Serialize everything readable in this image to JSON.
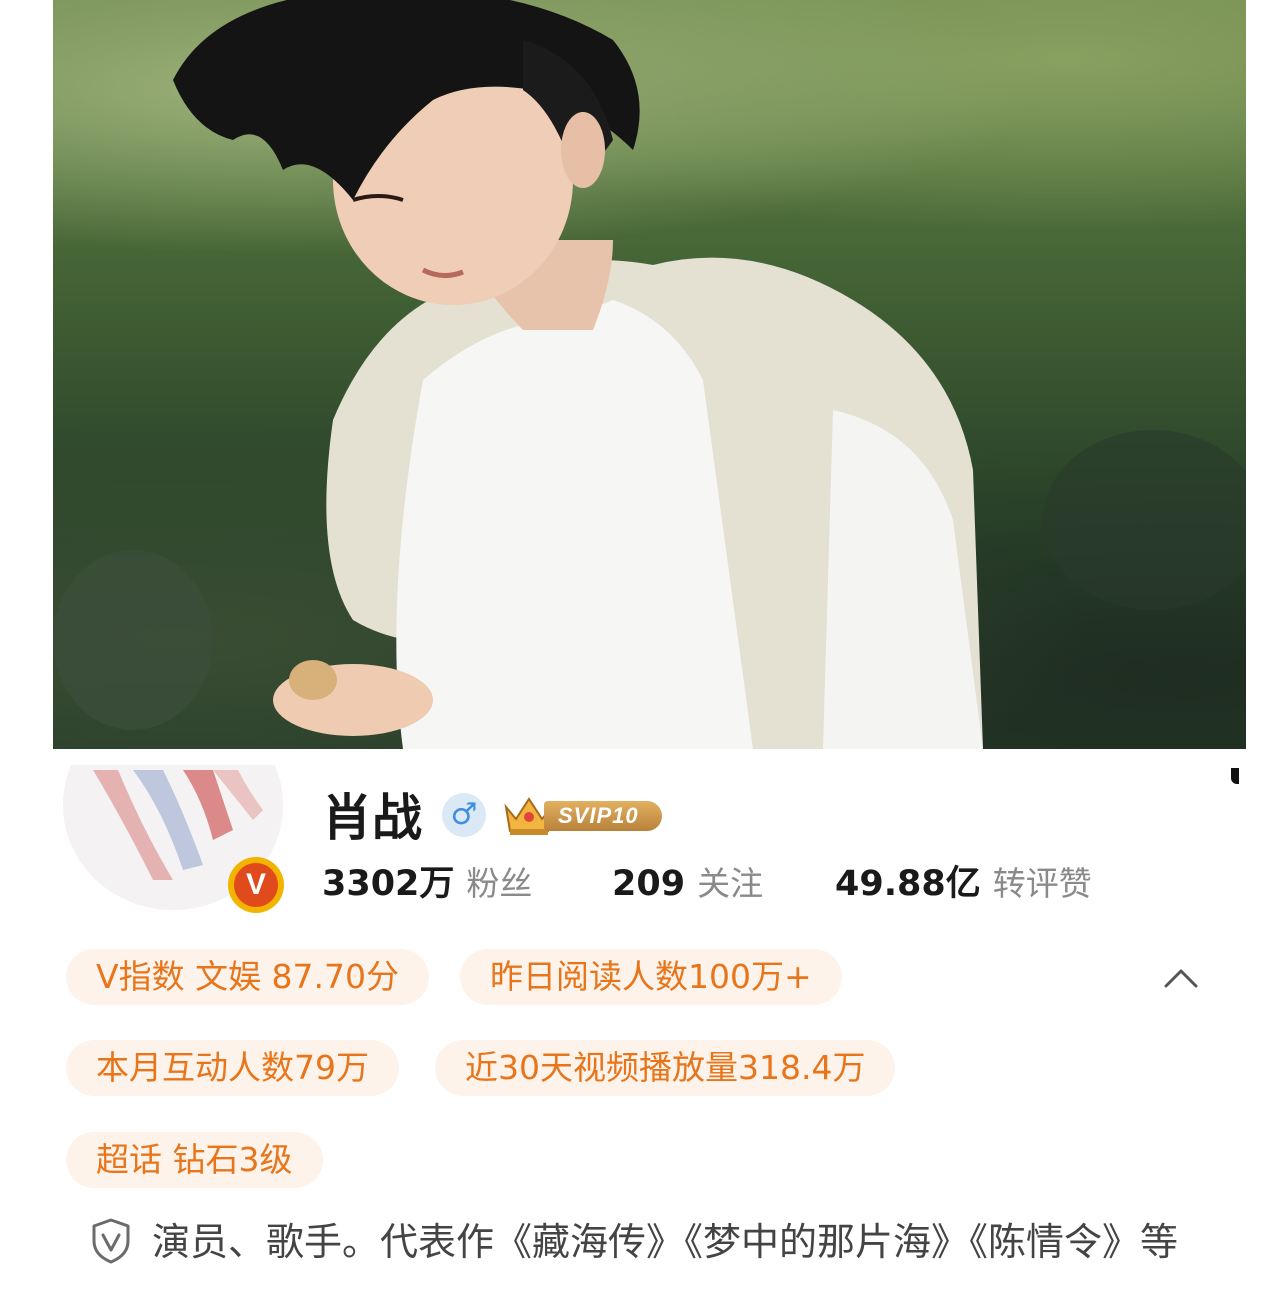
{
  "profile": {
    "name": "肖战",
    "gender_icon": "male-symbol-icon",
    "membership_badge": "SVIP10",
    "verified_badge_letter": "V"
  },
  "stats": {
    "fans_value": "3302万",
    "fans_label": "粉丝",
    "following_value": "209",
    "following_label": "关注",
    "engagement_value": "49.88亿",
    "engagement_label": "转评赞"
  },
  "tags": {
    "v_index": "V指数 文娱 87.70分",
    "yesterday_reads": "昨日阅读人数100万+",
    "monthly_interactions": "本月互动人数79万",
    "video_plays_30d": "近30天视频播放量318.4万",
    "super_topic": "超话 钻石3级"
  },
  "bio": {
    "icon": "verified-shield-icon",
    "text": "演员、歌手。代表作《藏海传》《梦中的那片海》《陈情令》等"
  },
  "colors": {
    "tag_bg": "#fdf3ea",
    "tag_text": "#e8751a",
    "gender_blue": "#3e8fe0",
    "v_badge_red": "#e04a1c",
    "v_badge_gold": "#f2b400"
  }
}
